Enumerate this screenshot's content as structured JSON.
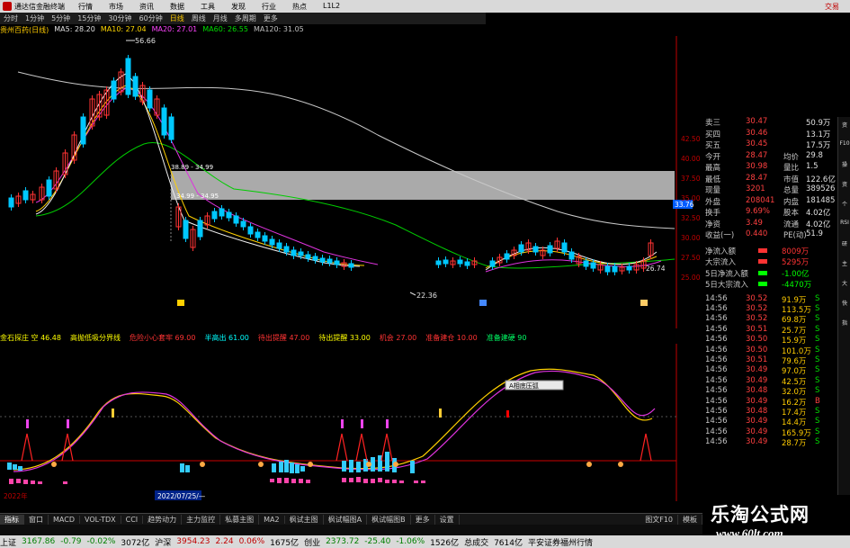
{
  "app": {
    "title": "通达信金融终端",
    "right_label": "交易"
  },
  "menu": [
    "行情",
    "市场",
    "资讯",
    "数据",
    "工具",
    "发现",
    "行业",
    "热点",
    "L1L2"
  ],
  "periods": [
    {
      "label": "分时",
      "active": false
    },
    {
      "label": "1分钟",
      "active": false
    },
    {
      "label": "5分钟",
      "active": false
    },
    {
      "label": "15分钟",
      "active": false
    },
    {
      "label": "30分钟",
      "active": false
    },
    {
      "label": "60分钟",
      "active": false
    },
    {
      "label": "日线",
      "active": true
    },
    {
      "label": "周线",
      "active": false
    },
    {
      "label": "月线",
      "active": false
    },
    {
      "label": "多周期",
      "active": false
    },
    {
      "label": "更多",
      "active": false
    }
  ],
  "ma_legend": {
    "stock": "贵州百药(日线)",
    "items": [
      {
        "text": "MA5: 28.20",
        "color": "#e0e0e0"
      },
      {
        "text": "MA10: 27.04",
        "color": "#ffd700"
      },
      {
        "text": "MA20: 27.01",
        "color": "#ff44ff"
      },
      {
        "text": "MA60: 26.55",
        "color": "#00dd00"
      },
      {
        "text": "MA120: 31.05",
        "color": "#c0c0c0"
      }
    ]
  },
  "price_labels": {
    "high": "56.66",
    "low": "22.36",
    "box_top": "38.89 - 34.99",
    "box_bottom": "34.99 - 34.95",
    "right_low": "26.74",
    "current": "33.76"
  },
  "price_axis": [
    "42.50",
    "40.00",
    "37.50",
    "35.00",
    "32.50",
    "30.00",
    "27.50",
    "25.00"
  ],
  "indicator_legend": [
    {
      "text": "金石探庄 空 46.48",
      "color": "#ffff00"
    },
    {
      "text": "高抛低吸分界线",
      "color": "#ffff00"
    },
    {
      "text": "危险小心套牢 69.00",
      "color": "#ff3333"
    },
    {
      "text": "半高出 61.00",
      "color": "#00ffff"
    },
    {
      "text": "待出提醒 47.00",
      "color": "#ff3333"
    },
    {
      "text": "待出提醒 33.00",
      "color": "#ffff00"
    },
    {
      "text": "机会 27.00",
      "color": "#ff3333"
    },
    {
      "text": "准备建仓 10.00",
      "color": "#ff3333"
    },
    {
      "text": "准备建硬 90",
      "color": "#00ff66"
    }
  ],
  "indicator_tooltip": "A相底压弧",
  "date_labels": {
    "left": "2022年",
    "mid": "2022/07/25/—"
  },
  "quote": [
    {
      "label": "卖三",
      "value": "30.47",
      "extra_label": "",
      "extra": "50.9万"
    },
    {
      "label": "买四",
      "value": "30.46",
      "extra_label": "",
      "extra": "13.1万"
    },
    {
      "label": "买五",
      "value": "30.45",
      "extra_label": "",
      "extra": "17.5万"
    },
    {
      "label": "今开",
      "value": "28.47",
      "extra_label": "均价",
      "extra": "29.8"
    },
    {
      "label": "最高",
      "value": "30.98",
      "extra_label": "量比",
      "extra": "1.5"
    },
    {
      "label": "最低",
      "value": "28.47",
      "extra_label": "市值",
      "extra": "122.6亿"
    },
    {
      "label": "现量",
      "value": "3201",
      "extra_label": "总量",
      "extra": "389526"
    },
    {
      "label": "外盘",
      "value": "208041",
      "extra_label": "内盘",
      "extra": "181485"
    },
    {
      "label": "换手",
      "value": "9.69%",
      "extra_label": "股本",
      "extra": "4.02亿"
    },
    {
      "label": "净资",
      "value": "3.49",
      "extra_label": "流通",
      "extra": "4.02亿"
    },
    {
      "label": "收益(一)",
      "value": "0.440",
      "extra_label": "PE(动)",
      "extra": "51.9"
    }
  ],
  "flows": [
    {
      "label": "净流入额",
      "value": "8009万",
      "color": "#ff3333"
    },
    {
      "label": "大宗流入",
      "value": "5295万",
      "color": "#ff3333"
    },
    {
      "label": "5日净流入额",
      "value": "-1.00亿",
      "color": "#00ff00"
    },
    {
      "label": "5日大宗流入",
      "value": "-4470万",
      "color": "#00ff00"
    }
  ],
  "ticks": [
    {
      "time": "14:56",
      "price": "30.52",
      "vol": "91.9万",
      "dir": "S"
    },
    {
      "time": "14:56",
      "price": "30.52",
      "vol": "113.5万",
      "dir": "S"
    },
    {
      "time": "14:56",
      "price": "30.52",
      "vol": "69.8万",
      "dir": "S"
    },
    {
      "time": "14:56",
      "price": "30.51",
      "vol": "25.7万",
      "dir": "S"
    },
    {
      "time": "14:56",
      "price": "30.50",
      "vol": "15.9万",
      "dir": "S"
    },
    {
      "time": "14:56",
      "price": "30.50",
      "vol": "101.0万",
      "dir": "S"
    },
    {
      "time": "14:56",
      "price": "30.51",
      "vol": "79.6万",
      "dir": "S"
    },
    {
      "time": "14:56",
      "price": "30.49",
      "vol": "97.0万",
      "dir": "S"
    },
    {
      "time": "14:56",
      "price": "30.49",
      "vol": "42.5万",
      "dir": "S"
    },
    {
      "time": "14:56",
      "price": "30.48",
      "vol": "32.0万",
      "dir": "S"
    },
    {
      "time": "14:56",
      "price": "30.49",
      "vol": "16.2万",
      "dir": "B"
    },
    {
      "time": "14:56",
      "price": "30.48",
      "vol": "17.4万",
      "dir": "S"
    },
    {
      "time": "14:56",
      "price": "30.49",
      "vol": "14.4万",
      "dir": "S"
    },
    {
      "time": "14:56",
      "price": "30.49",
      "vol": "165.9万",
      "dir": "S"
    },
    {
      "time": "14:56",
      "price": "30.49",
      "vol": "28.7万",
      "dir": "S"
    }
  ],
  "tabs": [
    "指标",
    "窗口",
    "MACD",
    "VOL-TDX",
    "CCI",
    "趋势动力",
    "主力监控",
    "私募主图",
    "MA2",
    "枫试主图",
    "枫试幅图A",
    "枫试幅图B",
    "更多",
    "设置"
  ],
  "tabs_right": "模板",
  "tabs_right_small": "图文F10",
  "status": [
    {
      "text": "上证",
      "color": "#000"
    },
    {
      "text": "3167.86",
      "color": "#008000"
    },
    {
      "text": "-0.79",
      "color": "#008000"
    },
    {
      "text": "-0.02%",
      "color": "#008000"
    },
    {
      "text": "3072亿",
      "color": "#000"
    },
    {
      "text": "沪深",
      "color": "#000"
    },
    {
      "text": "3954.23",
      "color": "#c00000"
    },
    {
      "text": "2.24",
      "color": "#c00000"
    },
    {
      "text": "0.06%",
      "color": "#c00000"
    },
    {
      "text": "1675亿",
      "color": "#000"
    },
    {
      "text": "创业",
      "color": "#000"
    },
    {
      "text": "2373.72",
      "color": "#008000"
    },
    {
      "text": "-25.40",
      "color": "#008000"
    },
    {
      "text": "-1.06%",
      "color": "#008000"
    },
    {
      "text": "1526亿",
      "color": "#000"
    },
    {
      "text": "总成交",
      "color": "#000"
    },
    {
      "text": "7614亿",
      "color": "#000"
    },
    {
      "text": "平安证券福州行情",
      "color": "#000"
    }
  ],
  "watermark": {
    "title": "乐淘公式网",
    "url": "www.60lt.com"
  },
  "sidebar": [
    "资",
    "F10",
    "操",
    "资",
    "个",
    "RSI",
    "研",
    "主",
    "大",
    "快",
    "指"
  ],
  "chart_data": {
    "type": "candlestick",
    "ma_series": [
      "MA5",
      "MA10",
      "MA20",
      "MA60",
      "MA120"
    ],
    "high": 56.66,
    "low": 22.36
  }
}
